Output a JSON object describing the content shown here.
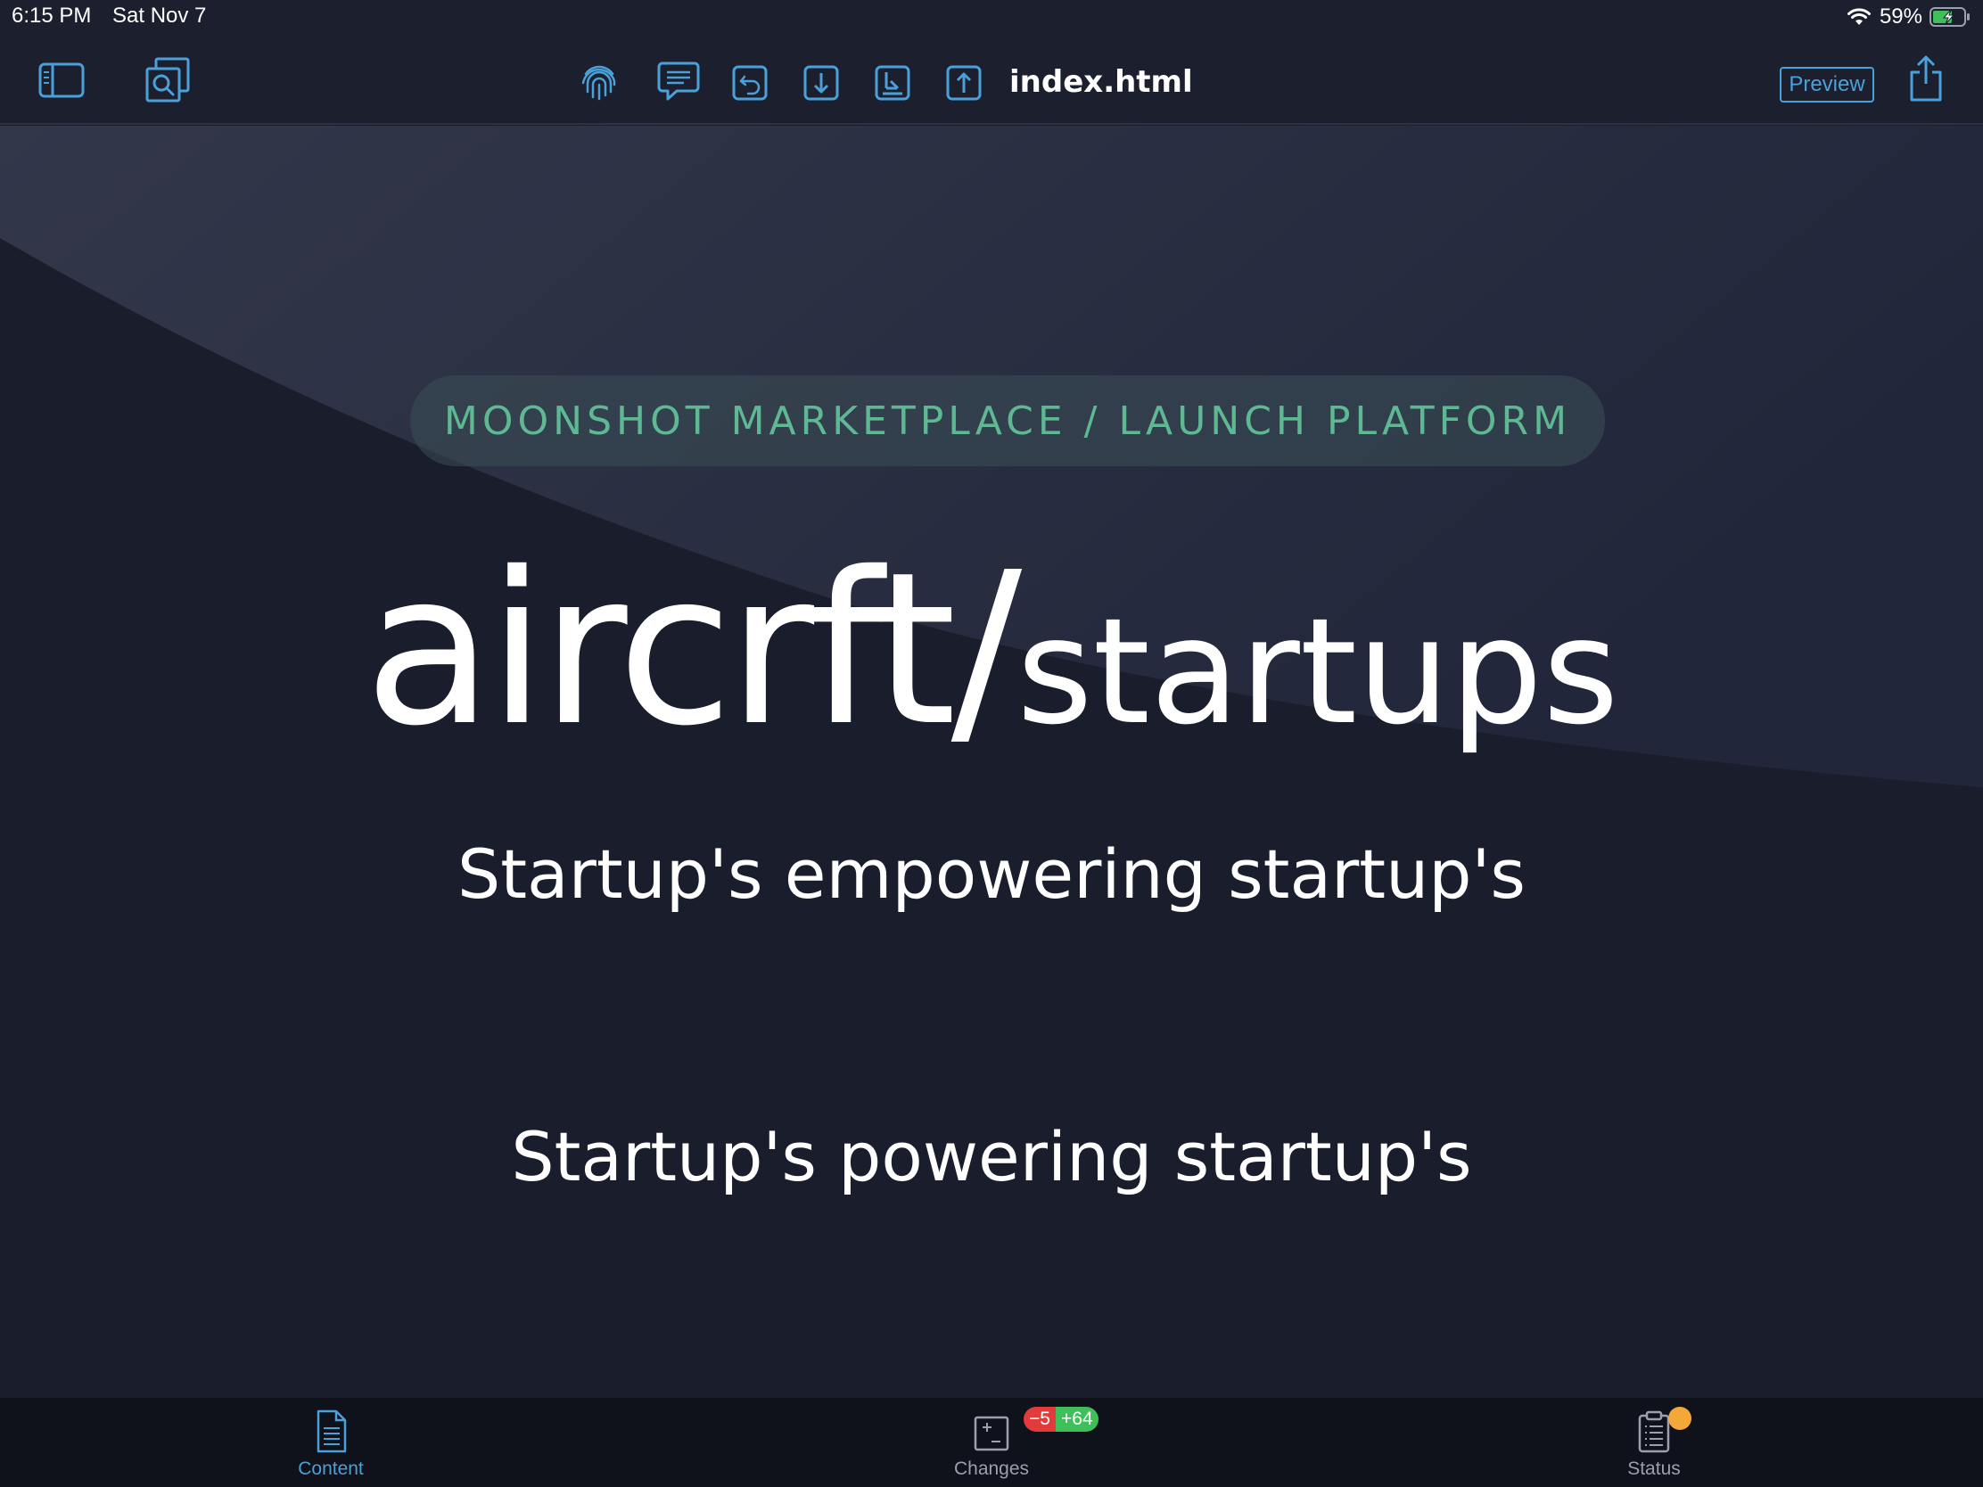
{
  "status_bar": {
    "time": "6:15 PM",
    "date": "Sat Nov 7",
    "battery_percent": "59%",
    "icons": [
      "wifi-icon",
      "battery-charging-icon"
    ]
  },
  "toolbar": {
    "filename": "index.html",
    "preview_label": "Preview",
    "icons": [
      "sidebar-toggle-icon",
      "search-files-icon",
      "fingerprint-icon",
      "comment-icon",
      "undo-icon",
      "download-icon",
      "pull-icon",
      "upload-icon",
      "share-icon"
    ],
    "accent_color": "#4aa0d8"
  },
  "page": {
    "eyebrow": "MOONSHOT MARKETPLACE / LAUNCH PLATFORM",
    "title_main": "aircrft/",
    "title_suffix": "startups",
    "tagline_1": "Startup's empowering startup's",
    "tagline_2": "Startup's powering startup's",
    "eyebrow_color": "#5fb894",
    "background_color": "#1a1d2c"
  },
  "tabbar": {
    "tabs": [
      {
        "label": "Content",
        "icon": "document-icon",
        "active": true
      },
      {
        "label": "Changes",
        "icon": "diff-icon",
        "active": false
      },
      {
        "label": "Status",
        "icon": "clipboard-icon",
        "active": false
      }
    ],
    "changes_removed": "−5",
    "changes_added": "+64"
  }
}
